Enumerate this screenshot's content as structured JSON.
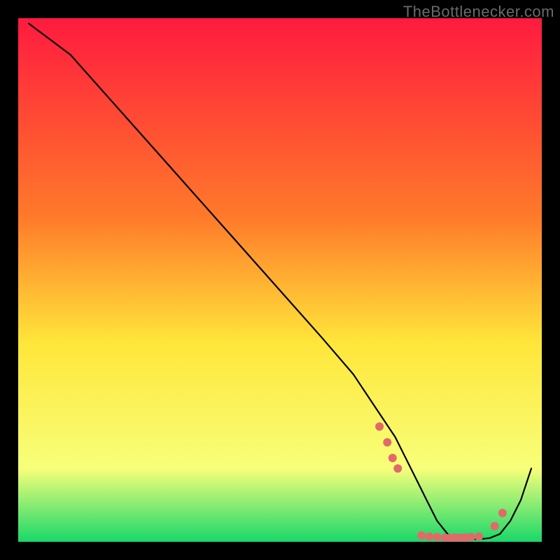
{
  "watermark": "TheBottlenecker.com",
  "chart_data": {
    "type": "line",
    "title": "",
    "xlabel": "",
    "ylabel": "",
    "xlim": [
      0,
      100
    ],
    "ylim": [
      0,
      100
    ],
    "grid": false,
    "axes_visible": false,
    "background_gradient": {
      "top": "#ff1a3f",
      "mid1": "#ff7a2a",
      "mid2": "#ffe63a",
      "mid3": "#f7ff7a",
      "bottom": "#18d86a"
    },
    "series": [
      {
        "name": "bottleneck-curve",
        "color": "#000000",
        "x": [
          2,
          4,
          6,
          10,
          18,
          26,
          34,
          42,
          50,
          58,
          64,
          68,
          72,
          74,
          76,
          78,
          80,
          82,
          84,
          86,
          88,
          90,
          92,
          94,
          96,
          98
        ],
        "y": [
          99,
          97.5,
          96,
          93,
          84,
          75,
          66,
          57,
          48,
          39,
          32,
          26,
          20,
          16,
          12,
          8,
          4,
          1.5,
          0.7,
          0.5,
          0.5,
          0.7,
          1.5,
          4,
          8,
          14
        ]
      }
    ],
    "markers": {
      "name": "highlight-dots",
      "color": "#e06a6a",
      "x": [
        69,
        70.5,
        71.5,
        72.5,
        77,
        78.5,
        80,
        81.5,
        82.5,
        83.5,
        84.5,
        85.5,
        86.5,
        88,
        91,
        92.5
      ],
      "y": [
        22,
        19,
        16,
        14,
        1.2,
        1.0,
        0.9,
        0.8,
        0.8,
        0.8,
        0.8,
        0.8,
        0.9,
        1.0,
        3.0,
        5.5
      ]
    }
  }
}
